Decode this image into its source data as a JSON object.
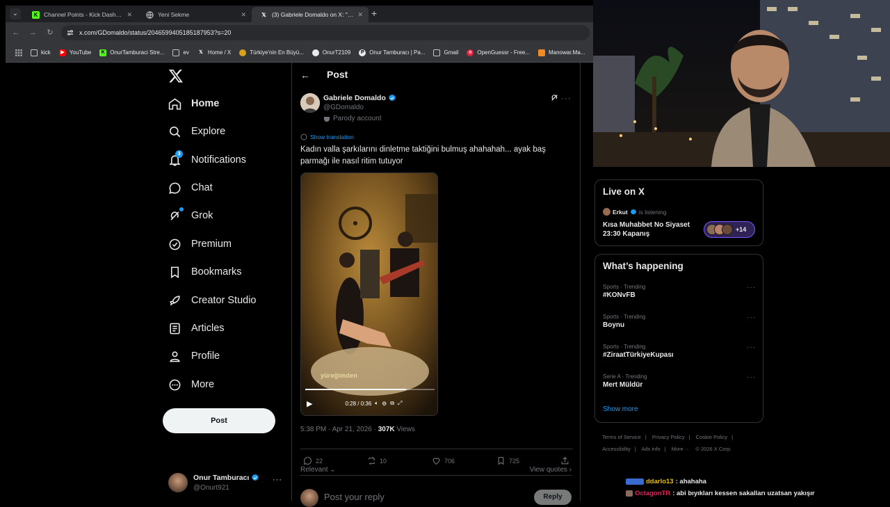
{
  "browser": {
    "tabs": [
      {
        "title": "Channel Points - Kick Dashboard",
        "favicon": "kick-icon",
        "active": false
      },
      {
        "title": "Yeni Sekme",
        "favicon": "globe-icon",
        "active": false
      },
      {
        "title": "(3) Gabriele Domaldo on X: \"Kadın",
        "favicon": "x-icon",
        "active": true
      }
    ],
    "url": "x.com/GDomaldo/status/2046599405185187953?s=20",
    "bookmarks": [
      {
        "label": "kick",
        "icon": "folder-icon"
      },
      {
        "label": "YouTube",
        "icon": "youtube-icon"
      },
      {
        "label": "OnurTamburaci Stre...",
        "icon": "kick-icon"
      },
      {
        "label": "ev",
        "icon": "folder-icon"
      },
      {
        "label": "Home / X",
        "icon": "x-icon"
      },
      {
        "label": "Türkiye'nin En Büyü...",
        "icon": "site-icon"
      },
      {
        "label": "OnurT2109",
        "icon": "github-icon"
      },
      {
        "label": "Onur Tamburacı | Pa...",
        "icon": "patreon-icon"
      },
      {
        "label": "Gmail",
        "icon": "folder-icon"
      },
      {
        "label": "OpenGuessr - Free...",
        "icon": "opengeussr-icon"
      },
      {
        "label": "Manowar.Ma...",
        "icon": "site-icon"
      }
    ]
  },
  "nav": {
    "items": [
      {
        "label": "Home",
        "icon": "home-icon"
      },
      {
        "label": "Explore",
        "icon": "search-icon"
      },
      {
        "label": "Notifications",
        "icon": "bell-icon",
        "badge": "3"
      },
      {
        "label": "Chat",
        "icon": "chat-icon"
      },
      {
        "label": "Grok",
        "icon": "grok-icon"
      },
      {
        "label": "Premium",
        "icon": "premium-icon"
      },
      {
        "label": "Bookmarks",
        "icon": "bookmark-icon"
      },
      {
        "label": "Creator Studio",
        "icon": "rocket-icon"
      },
      {
        "label": "Articles",
        "icon": "articles-icon"
      },
      {
        "label": "Profile",
        "icon": "person-icon"
      },
      {
        "label": "More",
        "icon": "more-circle-icon"
      }
    ],
    "post_button": "Post",
    "account": {
      "name": "Onur Tamburacı",
      "handle": "@Onurt921"
    }
  },
  "main": {
    "header": "Post",
    "author": {
      "name": "Gabriele Domaldo",
      "handle": "@GDomaldo",
      "label": "Parody account"
    },
    "show_translation": "Show translation",
    "text": "Kadın valla şarkılarını dinletme taktiğini bulmuş ahahahah... ayak baş parmağı ile nasıl ritim tutuyor",
    "video": {
      "caption": "yüreğimden",
      "time": "0:28 / 0:36",
      "progress": 0.78
    },
    "meta": {
      "time": "5:38 PM · Apr 21, 2026 · ",
      "views": "307K",
      "views_label": " Views"
    },
    "actions": {
      "replies": "22",
      "reposts": "10",
      "likes": "706",
      "bookmarks": "725"
    },
    "relevant": "Relevant",
    "view_quotes": "View quotes",
    "reply_placeholder": "Post your reply",
    "reply_button": "Reply"
  },
  "sidebar": {
    "live": {
      "title": "Live on X",
      "host": "Erkut",
      "status": "is listening",
      "space_title": "Kısa Muhabbet No Siyaset 23:30 Kapanış",
      "listeners_extra": "+14"
    },
    "happening": {
      "title": "What’s happening",
      "trends": [
        {
          "category": "Sports · Trending",
          "name": "#KONvFB"
        },
        {
          "category": "Sports · Trending",
          "name": "Boynu"
        },
        {
          "category": "Sports · Trending",
          "name": "#ZiraatTürkiyeKupası"
        },
        {
          "category": "Serie A · Trending",
          "name": "Mert Müldür"
        }
      ],
      "show_more": "Show more"
    },
    "footer": [
      "Terms of Service",
      "|",
      "Privacy Policy",
      "|",
      "Cookie Policy",
      "|",
      "Accessibility",
      "|",
      "Ads info",
      "|",
      "More ···",
      "© 2026 X Corp."
    ]
  },
  "stream_chat": [
    {
      "user": "ddarlo13",
      "color": "#e5c100",
      "message": ": ahahaha"
    },
    {
      "user": "OctagonTR",
      "color": "#e0245e",
      "message": ": abi bıyıkları kessen sakalları uzatsan yakışır"
    }
  ],
  "colors": {
    "accent": "#1d9bf0",
    "background": "#000000",
    "border": "#2f3336"
  }
}
